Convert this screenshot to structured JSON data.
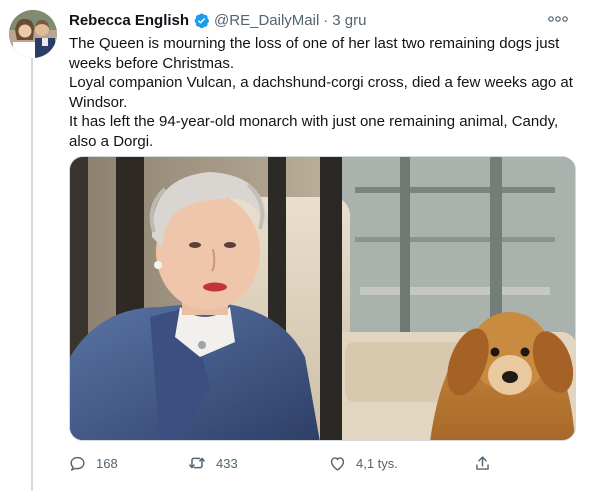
{
  "tweet": {
    "author": {
      "name": "Rebecca English",
      "handle": "@RE_DailyMail",
      "verified": true,
      "separator": "·",
      "time": "3 gru"
    },
    "text_lines": [
      "The Queen is mourning the loss of one of her last two remaining dogs just weeks before Christmas.",
      "Loyal companion Vulcan, a dachshund-corgi cross, died a few weeks ago at Windsor.",
      "It has left the 94-year-old monarch with just one remaining animal, Candy, also a Dorgi."
    ],
    "media": {
      "kind": "photo"
    },
    "actions": {
      "reply_count": "168",
      "retweet_count": "433",
      "like_count": "4,1 tys."
    }
  },
  "icons": {
    "verified": "verified-badge-icon",
    "more": "more-options-icon",
    "reply": "reply-icon",
    "retweet": "retweet-icon",
    "like": "heart-icon",
    "share": "share-icon"
  },
  "colors": {
    "primary_text": "#0f1419",
    "secondary_text": "#536471",
    "verified_blue": "#1d9bf0",
    "border": "#cfd9de"
  }
}
